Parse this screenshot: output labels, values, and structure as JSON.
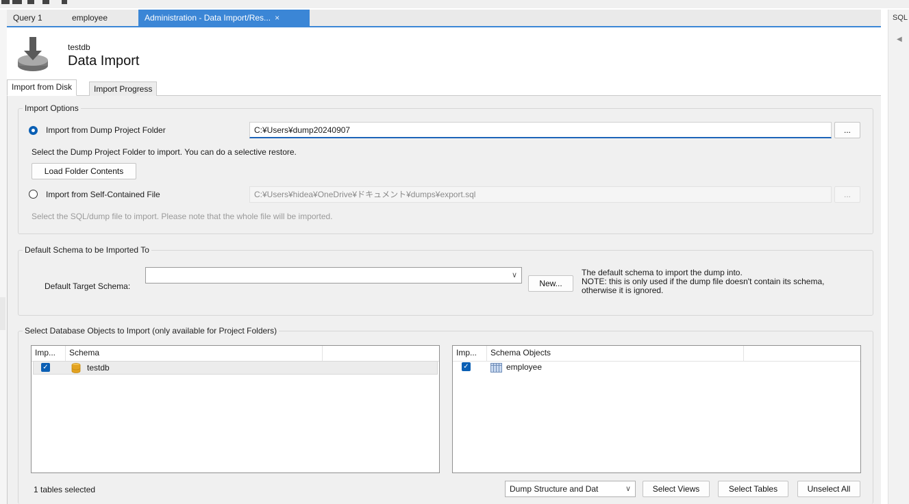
{
  "tabs": [
    {
      "label": "Query 1",
      "active": false
    },
    {
      "label": "employee",
      "active": false
    },
    {
      "label": "Administration - Data Import/Res...",
      "active": true
    }
  ],
  "tab_close_glyph": "×",
  "right_panel": {
    "label": "SQL",
    "arrow": "◀"
  },
  "header": {
    "schema_name": "testdb",
    "title": "Data Import"
  },
  "subtabs": [
    "Import from Disk",
    "Import Progress"
  ],
  "import_options": {
    "title": "Import Options",
    "dump_folder_label": "Import from Dump Project Folder",
    "dump_folder_value": "C:¥Users¥dump20240907",
    "dump_folder_selected": true,
    "browse_label": "...",
    "folder_hint": "Select the Dump Project Folder to import. You can do a selective restore.",
    "load_button": "Load Folder Contents",
    "self_file_label": "Import from Self-Contained File",
    "self_file_value": "C:¥Users¥hidea¥OneDrive¥ドキュメント¥dumps¥export.sql",
    "self_file_hint": "Select the SQL/dump file to import. Please note that the whole file will be imported."
  },
  "default_schema": {
    "title": "Default Schema to be Imported To",
    "target_label": "Default Target Schema:",
    "target_value": "",
    "new_button": "New...",
    "note_lines": [
      "The default schema to import the dump into.",
      "NOTE: this is only used if the dump file doesn't contain its schema,",
      "otherwise it is ignored."
    ]
  },
  "objects": {
    "title": "Select Database Objects to Import (only available for Project Folders)",
    "schema_list": {
      "col_import": "Imp...",
      "col_name": "Schema",
      "rows": [
        {
          "name": "testdb",
          "checked": true
        }
      ]
    },
    "object_list": {
      "col_import": "Imp...",
      "col_name": "Schema Objects",
      "rows": [
        {
          "name": "employee",
          "checked": true
        }
      ]
    },
    "status": "1 tables selected",
    "dump_select_value": "Dump Structure and Dat",
    "select_views": "Select Views",
    "select_tables": "Select Tables",
    "unselect_all": "Unselect All"
  },
  "icons": {
    "import": "download-disk-icon",
    "schema": "database-icon",
    "table": "table-icon",
    "check": "checkbox-checked-icon"
  },
  "colors": {
    "accent": "#3b86d6",
    "radio": "#0a5fb4",
    "checkbox": "#0a5fb4",
    "db_icon": "#e3a321"
  }
}
